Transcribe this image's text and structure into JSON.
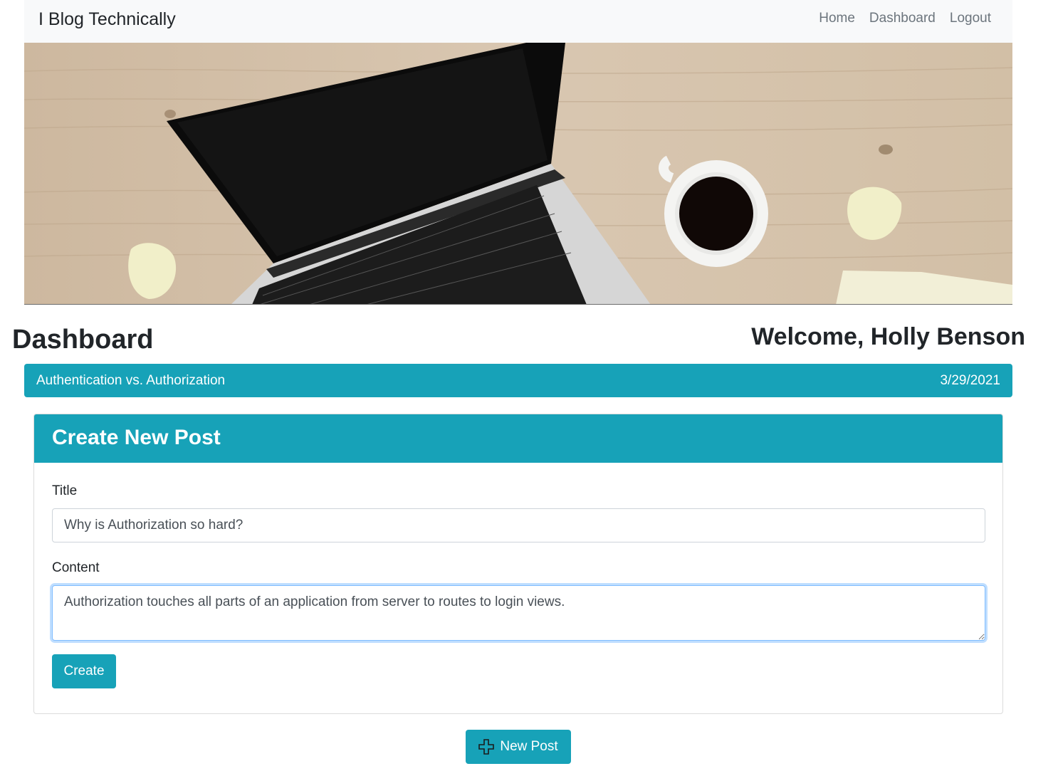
{
  "navbar": {
    "brand": "I Blog Technically",
    "links": [
      "Home",
      "Dashboard",
      "Logout"
    ]
  },
  "hero": {
    "image_description_icon": "laptop-coffee-desk-illustration"
  },
  "dashboard": {
    "title": "Dashboard",
    "welcome": "Welcome, Holly Benson"
  },
  "posts": [
    {
      "title": "Authentication vs. Authorization",
      "date": "3/29/2021"
    }
  ],
  "create_form": {
    "header": "Create New Post",
    "title_label": "Title",
    "title_value": "Why is Authorization so hard?",
    "content_label": "Content",
    "content_value": "Authorization touches all parts of an application from server to routes to login views.",
    "submit_label": "Create"
  },
  "new_post_button": {
    "label": "New Post",
    "icon": "plus-icon"
  },
  "colors": {
    "accent": "#17a2b8",
    "navbar_bg": "#f8f9fa",
    "nav_link": "#6c757d"
  }
}
